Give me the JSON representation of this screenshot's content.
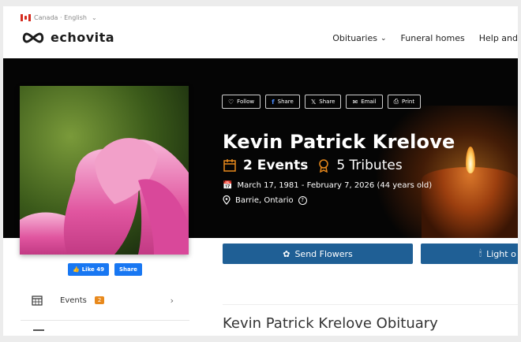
{
  "locale": {
    "label": "Canada · English"
  },
  "header": {
    "brand": "echovita",
    "nav": [
      {
        "label": "Obituaries",
        "has_dropdown": true
      },
      {
        "label": "Funeral homes",
        "has_dropdown": false
      },
      {
        "label": "Help and",
        "has_dropdown": false
      }
    ]
  },
  "share_buttons": [
    {
      "label": "Follow",
      "icon": "heart-icon"
    },
    {
      "label": "Share",
      "icon": "facebook-icon"
    },
    {
      "label": "Share",
      "icon": "x-icon"
    },
    {
      "label": "Email",
      "icon": "envelope-icon"
    },
    {
      "label": "Print",
      "icon": "printer-icon"
    }
  ],
  "person": {
    "name": "Kevin Patrick Krelove",
    "events": "2 Events",
    "tributes": "5 Tributes",
    "dates": "March 17, 1981 - February 7, 2026 (44 years old)",
    "location": "Barrie, Ontario",
    "help_mark": "?"
  },
  "facebook": {
    "like_label": "Like 49",
    "share_label": "Share"
  },
  "actions": {
    "flowers": "Send Flowers",
    "light": "Light o"
  },
  "sidebar": {
    "events_label": "Events",
    "events_count": "2"
  },
  "obituary": {
    "title": "Kevin Patrick Krelove Obituary"
  },
  "colors": {
    "hero_bg": "#050505",
    "primary_button": "#1f5f95",
    "badge": "#e8891c",
    "facebook_blue": "#1877f2",
    "events_icon": "#e8891c"
  }
}
